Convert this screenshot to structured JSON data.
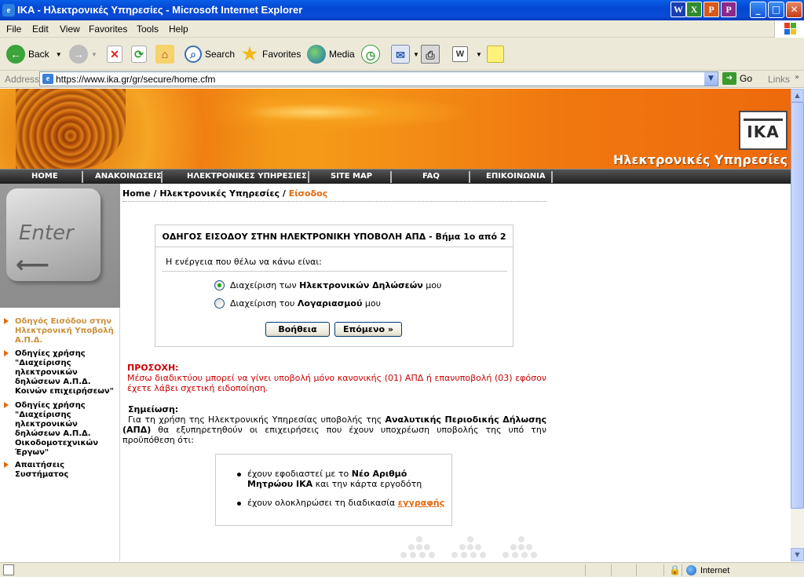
{
  "window": {
    "title": "IKA - Ηλεκτρονικές Υπηρεσίες - Microsoft Internet Explorer",
    "controls": {
      "minimize": "_",
      "maximize": "□",
      "close": "✕"
    }
  },
  "menu": [
    "File",
    "Edit",
    "View",
    "Favorites",
    "Tools",
    "Help"
  ],
  "toolbar": {
    "back": "Back",
    "search": "Search",
    "favorites": "Favorites",
    "media": "Media"
  },
  "address": {
    "label": "Address",
    "url": "https://www.ika.gr/gr/secure/home.cfm",
    "go": "Go",
    "links": "Links"
  },
  "site": {
    "logo": "IKA",
    "banner_title": "Ηλεκτρονικές Υπηρεσίες",
    "nav": [
      "HOME",
      "ΑΝΑΚΟΙΝΩΣΕΙΣ",
      "ΗΛΕΚΤΡΟΝΙΚΕΣ ΥΠΗΡΕΣΙΕΣ",
      "SITE MAP",
      "FAQ",
      "ΕΠΙΚΟΙΝΩΝΙΑ"
    ],
    "enter_key": "Enter",
    "enter_arrow": "⟵"
  },
  "breadcrumb": {
    "home": "Home",
    "sep1": " / ",
    "section": "Ηλεκτρονικές Υπηρεσίες",
    "sep2": " / ",
    "current": "Είσοδος"
  },
  "sidebar": {
    "links": [
      {
        "label": "Οδηγός Εισόδου στην\nΗλεκτρονική Υποβολή\nΑ.Π.Δ.",
        "active": true
      },
      {
        "label": "Οδηγίες χρήσης\n\"Διαχείρισης\nηλεκτρονικών\nδηλώσεων Α.Π.Δ.\nΚοινών επιχειρήσεων\"",
        "active": false
      },
      {
        "label": "Οδηγίες χρήσης\n\"Διαχείρισης\nηλεκτρονικών\nδηλώσεων Α.Π.Δ.\nΟικοδομοτεχνικών\nΈργων\"",
        "active": false
      },
      {
        "label": "Απαιτήσεις\nΣυστήματος",
        "active": false
      }
    ]
  },
  "wizard": {
    "title": "ΟΔΗΓΟΣ ΕΙΣΟΔΟΥ ΣΤΗΝ ΗΛΕΚΤΡΟΝΙΚΗ ΥΠΟΒΟΛΗ ΑΠΔ - Βήμα 1ο από 2",
    "question": "Η ενέργεια που θέλω να κάνω είναι:",
    "options": [
      {
        "pre": "Διαχείριση των ",
        "bold": "Ηλεκτρονικών Δηλώσεών",
        "post": " μου",
        "selected": true
      },
      {
        "pre": "Διαχείριση του ",
        "bold": "Λογαριασμού",
        "post": " μου",
        "selected": false
      }
    ],
    "help_button": "Βοήθεια",
    "next_button": "Επόμενο »"
  },
  "warning": {
    "title": "ΠΡΟΣΟΧΗ:",
    "text": "Μέσω διαδικτύου μπορεί να γίνει υποβολή μόνο κανονικής (01) ΑΠΔ ή επανυποβολή (03) εφόσον έχετε λάβει σχετική ειδοποίηση."
  },
  "note": {
    "title": "Σημείωση:",
    "pre": "Για τη χρήση της Ηλεκτρονικής Υπηρεσίας υποβολής της ",
    "bold": "Αναλυτικής Περιοδικής Δήλωσης (ΑΠΔ)",
    "post": " θα εξυπηρετηθούν οι επιχειρήσεις που έχουν υποχρέωση υποβολής της υπό την προϋπόθεση ότι:"
  },
  "requirements": [
    {
      "pre": "έχουν εφοδιαστεί με το ",
      "bold": "Νέο Αριθμό Μητρώου ΙΚΑ",
      "post": " και την κάρτα εργοδότη"
    },
    {
      "pre": "έχουν ολοκληρώσει τη διαδικασία ",
      "link": "εγγραφής",
      "post": ""
    }
  ],
  "status": {
    "zone": "Internet"
  },
  "colors": {
    "accent": "#e06a10",
    "warning": "#cc0000",
    "title_bar": "#0a5ee6",
    "active_link": "#c98f3a"
  }
}
